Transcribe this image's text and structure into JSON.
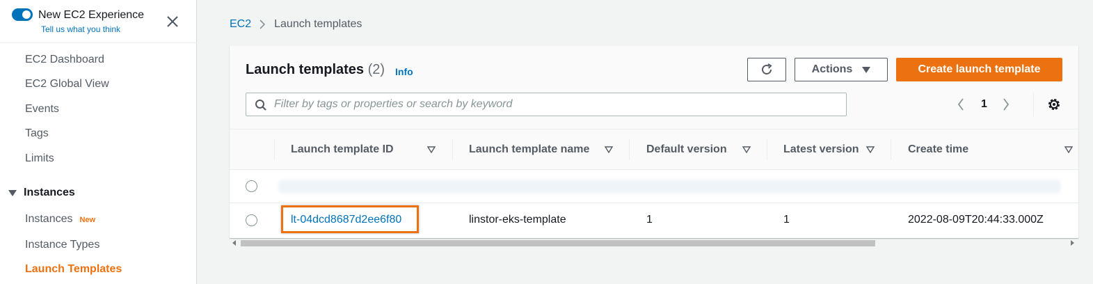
{
  "sidebar": {
    "experience_title": "New EC2 Experience",
    "experience_link": "Tell us what you think",
    "items": [
      {
        "label": "EC2 Dashboard"
      },
      {
        "label": "EC2 Global View"
      },
      {
        "label": "Events"
      },
      {
        "label": "Tags"
      },
      {
        "label": "Limits"
      }
    ],
    "section": {
      "label": "Instances",
      "items": [
        {
          "label": "Instances",
          "badge": "New"
        },
        {
          "label": "Instance Types"
        },
        {
          "label": "Launch Templates"
        }
      ]
    }
  },
  "breadcrumb": {
    "root": "EC2",
    "current": "Launch templates"
  },
  "panel": {
    "title": "Launch templates",
    "count": "(2)",
    "info": "Info",
    "actions_label": "Actions",
    "create_label": "Create launch template",
    "search_placeholder": "Filter by tags or properties or search by keyword",
    "page": "1"
  },
  "table": {
    "columns": [
      "Launch template ID",
      "Launch template name",
      "Default version",
      "Latest version",
      "Create time"
    ],
    "rows": [
      {
        "id": "lt-04dcd8687d2ee6f80",
        "name": "linstor-eks-template",
        "default_version": "1",
        "latest_version": "1",
        "create_time": "2022-08-09T20:44:33.000Z"
      }
    ]
  },
  "colors": {
    "accent": "#ec7211",
    "link": "#0073bb"
  }
}
